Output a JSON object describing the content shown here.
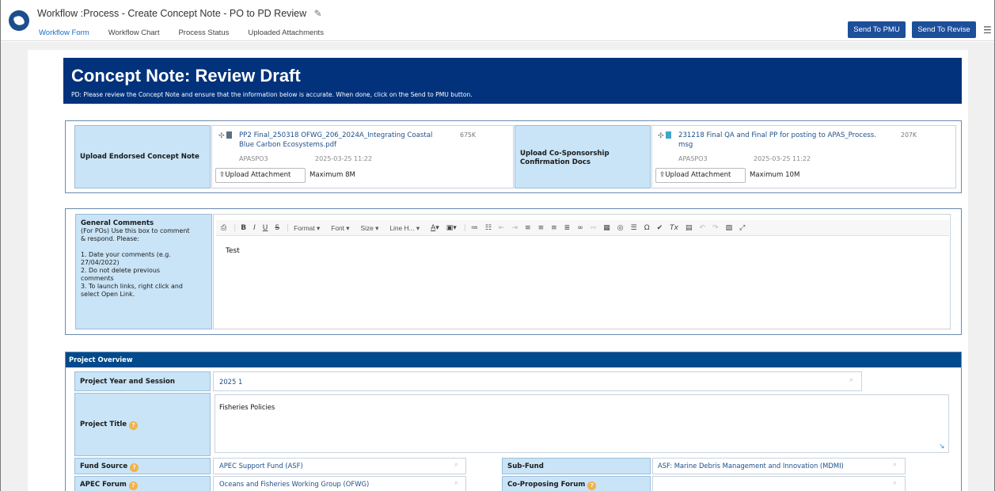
{
  "header": {
    "title": "Workflow :Process - Create Concept Note - PO to PD Review",
    "tabs": [
      "Workflow Form",
      "Workflow Chart",
      "Process Status",
      "Uploaded Attachments"
    ],
    "send_pmu": "Send To PMU",
    "send_revise": "Send To Revise"
  },
  "banner": {
    "title": "Concept Note: Review Draft",
    "subtitle": "PD: Please review the Concept Note and ensure that the information below is accurate. When done, click on the Send to PMU button."
  },
  "attachments": {
    "endorsed_label": "Upload Endorsed Concept Note",
    "endorsed_file_line1": "PP2 Final_250318 OFWG_206_2024A_Integrating Coastal",
    "endorsed_file_line2": "Blue Carbon Ecosystems.pdf",
    "endorsed_size": "675K",
    "endorsed_user": "APASPO3",
    "endorsed_date": "2025-03-25 11:22",
    "endorsed_upload": "Upload Attachment",
    "endorsed_max": "Maximum 8M",
    "cosponsor_label_line1": "Upload Co-Sponsorship",
    "cosponsor_label_line2": "Confirmation Docs",
    "cosponsor_file_line1": "231218 Final QA and Final PP for posting to APAS_Process.",
    "cosponsor_file_line2": "msg",
    "cosponsor_size": "207K",
    "cosponsor_user": "APASPO3",
    "cosponsor_date": "2025-03-25 11:22",
    "cosponsor_upload": "Upload Attachment",
    "cosponsor_max": "Maximum 10M"
  },
  "comments": {
    "heading": "General Comments",
    "lines": [
      "(For POs) Use this box to comment",
      "& respond. Please:",
      "",
      "1. Date your comments (e.g.",
      "27/04/2022)",
      "2. Do not delete previous",
      "comments",
      "3. To launch links, right click and",
      "select Open Link."
    ],
    "toolbar": {
      "format": "Format",
      "font": "Font",
      "size": "Size",
      "line_height": "Line H..."
    },
    "body_text": "Test"
  },
  "overview": {
    "heading": "Project Overview",
    "year_label": "Project Year and Session",
    "year_value": "2025 1",
    "title_label": "Project Title",
    "title_value": "Fisheries Policies",
    "fund_label": "Fund Source",
    "fund_value": "APEC Support Fund (ASF)",
    "subfund_label": "Sub-Fund",
    "subfund_value": "ASF: Marine Debris Management and Innovation (MDMI)",
    "forum_label": "APEC Forum",
    "forum_value": "Oceans and Fisheries Working Group (OFWG)",
    "coforum_label": "Co-Proposing Forum",
    "coforum_value": ""
  }
}
